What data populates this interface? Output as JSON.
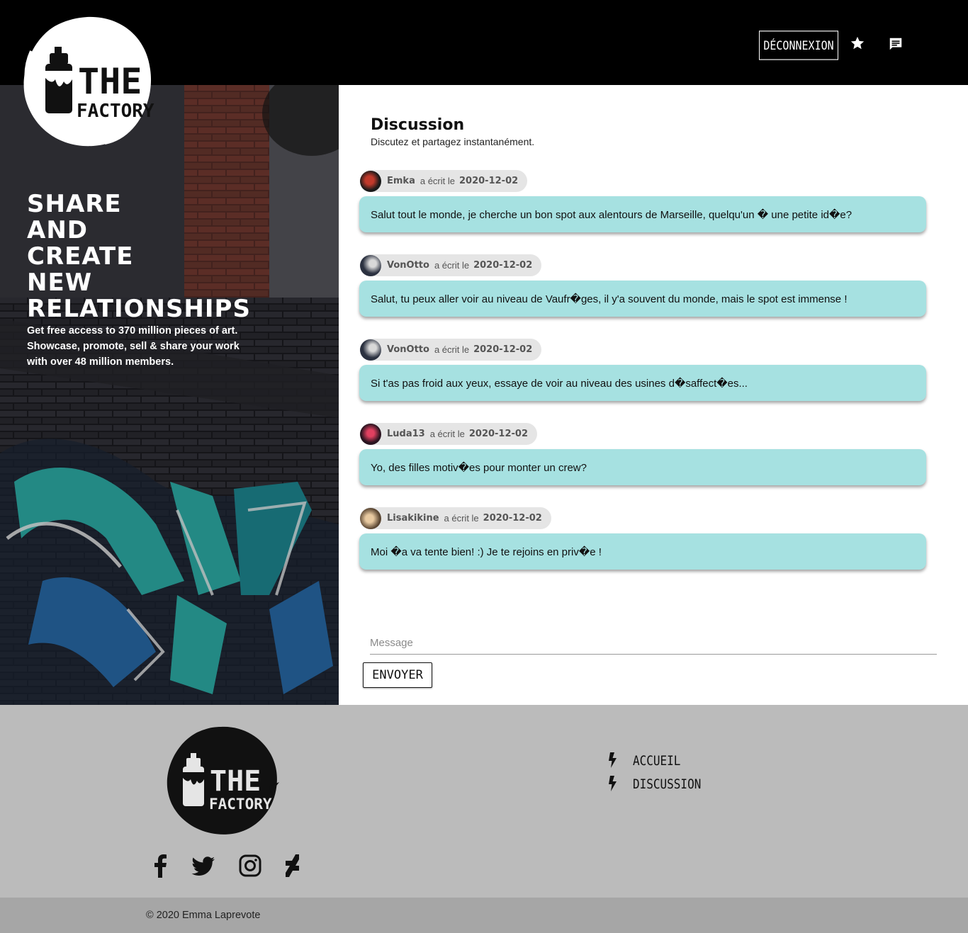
{
  "header": {
    "logout_label": "DÉCONNEXION",
    "icons": [
      "star-icon",
      "chat-icon"
    ]
  },
  "brand": {
    "logo_text_top": "THE",
    "logo_text_bottom": "FACTORY"
  },
  "hero": {
    "title_lines": [
      "SHARE",
      "AND",
      "CREATE",
      "NEW",
      "RELATIONSHIPS"
    ],
    "subtitle_lines": [
      "Get free access to 370 million pieces of art.",
      "Showcase, promote, sell & share your work",
      "with over 48 million members."
    ]
  },
  "discussion": {
    "title": "Discussion",
    "subtitle": "Discutez et partagez instantanément.",
    "wrote_label": "a écrit le",
    "messages": [
      {
        "author": "Emka",
        "date": "2020-12-02",
        "text": "Salut tout le monde, je cherche un bon spot aux alentours de Marseille, quelqu'un � une petite id�e?"
      },
      {
        "author": "VonOtto",
        "date": "2020-12-02",
        "text": "Salut, tu peux aller voir au niveau de Vaufr�ges, il y'a souvent du monde, mais le spot est immense !"
      },
      {
        "author": "VonOtto",
        "date": "2020-12-02",
        "text": "Si t'as pas froid aux yeux, essaye de voir au niveau des usines d�saffect�es..."
      },
      {
        "author": "Luda13",
        "date": "2020-12-02",
        "text": "Yo, des filles motiv�es pour monter un crew?"
      },
      {
        "author": "Lisakikine",
        "date": "2020-12-02",
        "text": "Moi �a va tente bien! :) Je te rejoins en priv�e !"
      }
    ],
    "input_placeholder": "Message",
    "send_label": "ENVOYER"
  },
  "footer": {
    "social_icons": [
      "facebook-icon",
      "twitter-icon",
      "instagram-icon",
      "deviantart-icon"
    ],
    "links": [
      {
        "label": "ACCUEIL"
      },
      {
        "label": "DISCUSSION"
      }
    ],
    "copyright": "© 2020 Emma Laprevote"
  },
  "colors": {
    "header_bg": "#000000",
    "bubble_bg": "#a6e1e1",
    "meta_bg": "#e5e5e5",
    "footer_bg": "#bbbbbb",
    "copyright_bg": "#a6a6a6"
  }
}
